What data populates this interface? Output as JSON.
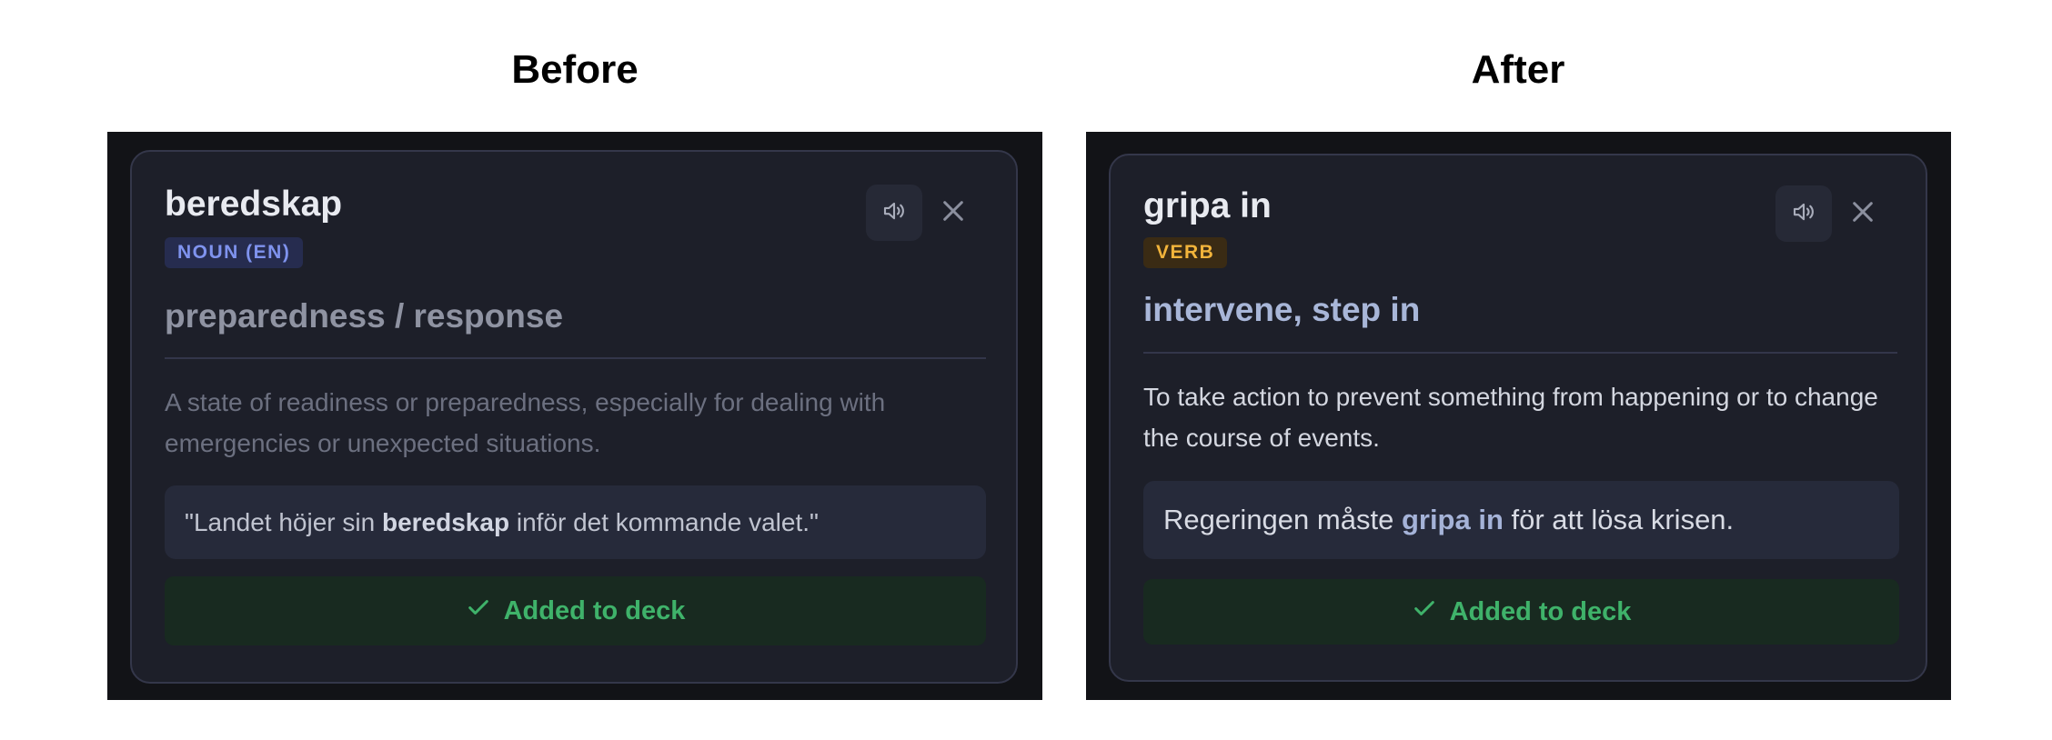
{
  "panels": {
    "before": {
      "heading": "Before",
      "word": "beredskap",
      "part_of_speech": "NOUN (EN)",
      "translation": "preparedness / response",
      "definition": "A state of readiness or preparedness, especially for dealing with emergencies or unexpected situations.",
      "example": {
        "prefix": "\"Landet höjer sin ",
        "highlight": "beredskap",
        "suffix": " inför det kommande valet.\""
      },
      "added_label": "Added to deck"
    },
    "after": {
      "heading": "After",
      "word": "gripa in",
      "part_of_speech": "VERB",
      "translation": "intervene, step in",
      "definition": "To take action to prevent something from happening or to change the course of events.",
      "example": {
        "prefix": "Regeringen måste ",
        "highlight": "gripa in",
        "suffix": " för att lösa krisen."
      },
      "added_label": "Added to deck"
    }
  },
  "icons": {
    "audio": "speaker-icon",
    "close": "close-icon",
    "added": "checkmark-icon"
  },
  "colors": {
    "page_background": "#ffffff",
    "frame_background": "#121317",
    "card_background": "#1d1f29",
    "noun_badge": "#7f93ee",
    "verb_badge": "#f2b43b",
    "added_green": "#3fb26a"
  }
}
